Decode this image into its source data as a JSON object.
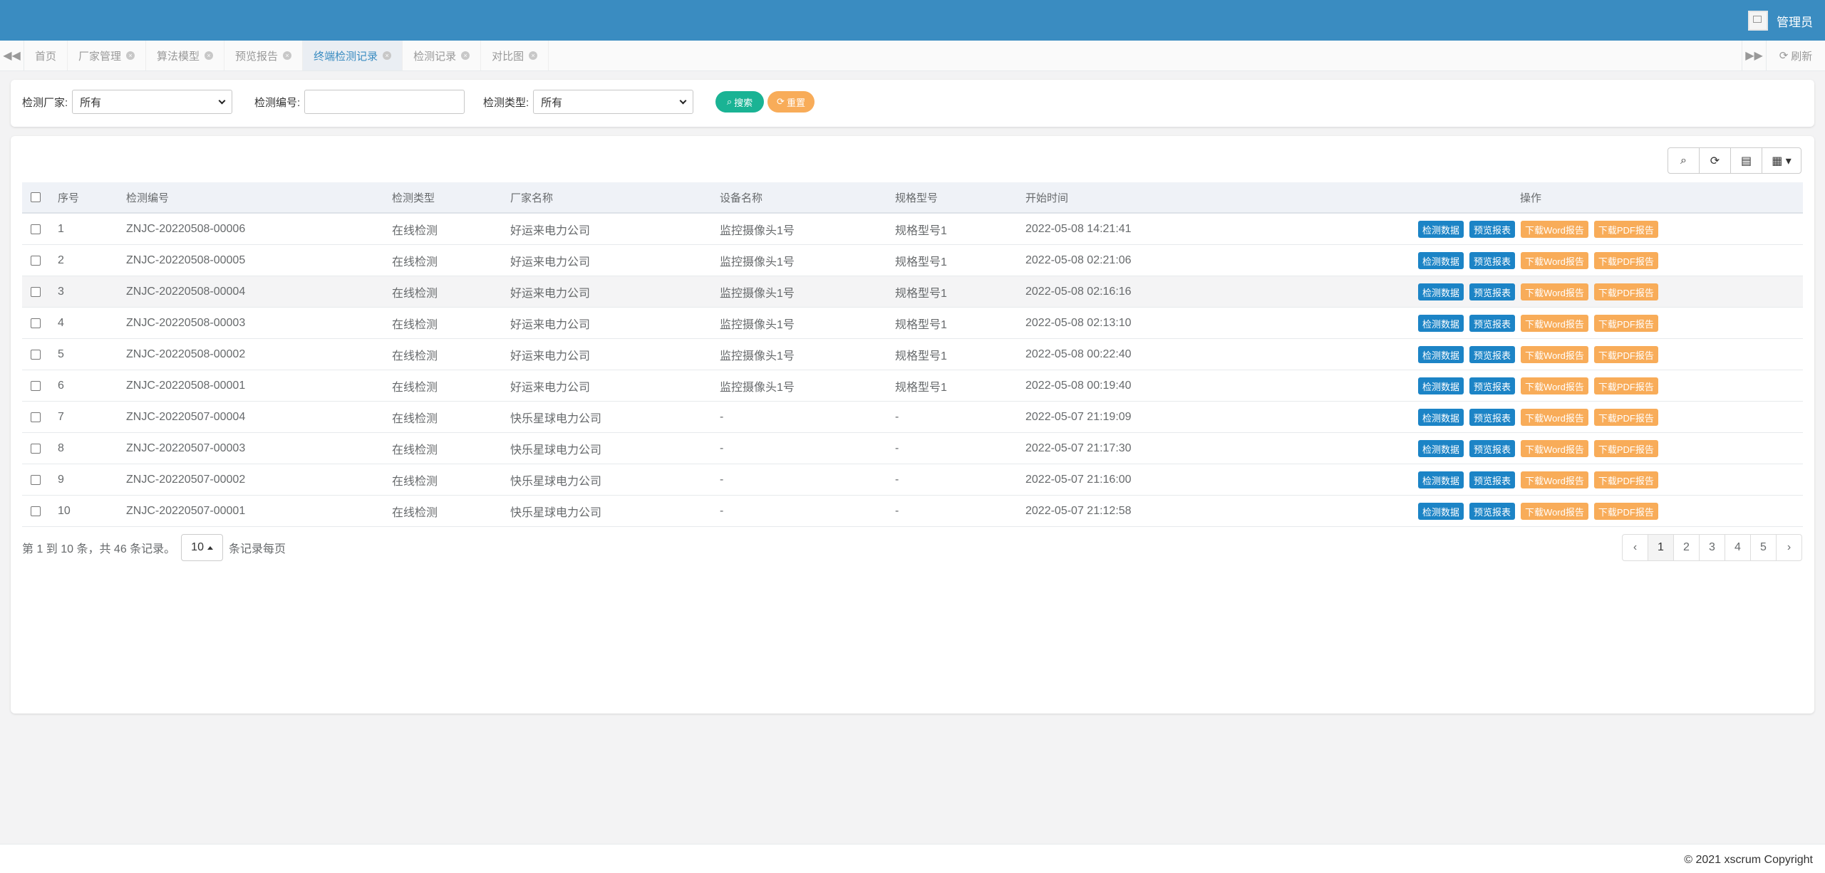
{
  "topbar": {
    "user_name": "管理员"
  },
  "tabs": [
    {
      "label": "首页",
      "closable": false,
      "active": false
    },
    {
      "label": "厂家管理",
      "closable": true,
      "active": false
    },
    {
      "label": "算法模型",
      "closable": true,
      "active": false
    },
    {
      "label": "预览报告",
      "closable": true,
      "active": false
    },
    {
      "label": "终端检测记录",
      "closable": true,
      "active": true
    },
    {
      "label": "检测记录",
      "closable": true,
      "active": false
    },
    {
      "label": "对比图",
      "closable": true,
      "active": false
    }
  ],
  "tabbar": {
    "refresh_label": "刷新"
  },
  "search": {
    "vendor_label": "检测厂家:",
    "vendor_value": "所有",
    "code_label": "检测编号:",
    "code_value": "",
    "type_label": "检测类型:",
    "type_value": "所有",
    "search_button": "搜索",
    "reset_button": "重置"
  },
  "table": {
    "columns": [
      "序号",
      "检测编号",
      "检测类型",
      "厂家名称",
      "设备名称",
      "规格型号",
      "开始时间",
      "操作"
    ],
    "ops": [
      "检测数据",
      "预览报表",
      "下载Word报告",
      "下载PDF报告"
    ],
    "rows": [
      {
        "no": "1",
        "code": "ZNJC-20220508-00006",
        "type": "在线检测",
        "vendor": "好运来电力公司",
        "device": "监控摄像头1号",
        "model": "规格型号1",
        "start": "2022-05-08 14:21:41"
      },
      {
        "no": "2",
        "code": "ZNJC-20220508-00005",
        "type": "在线检测",
        "vendor": "好运来电力公司",
        "device": "监控摄像头1号",
        "model": "规格型号1",
        "start": "2022-05-08 02:21:06"
      },
      {
        "no": "3",
        "code": "ZNJC-20220508-00004",
        "type": "在线检测",
        "vendor": "好运来电力公司",
        "device": "监控摄像头1号",
        "model": "规格型号1",
        "start": "2022-05-08 02:16:16"
      },
      {
        "no": "4",
        "code": "ZNJC-20220508-00003",
        "type": "在线检测",
        "vendor": "好运来电力公司",
        "device": "监控摄像头1号",
        "model": "规格型号1",
        "start": "2022-05-08 02:13:10"
      },
      {
        "no": "5",
        "code": "ZNJC-20220508-00002",
        "type": "在线检测",
        "vendor": "好运来电力公司",
        "device": "监控摄像头1号",
        "model": "规格型号1",
        "start": "2022-05-08 00:22:40"
      },
      {
        "no": "6",
        "code": "ZNJC-20220508-00001",
        "type": "在线检测",
        "vendor": "好运来电力公司",
        "device": "监控摄像头1号",
        "model": "规格型号1",
        "start": "2022-05-08 00:19:40"
      },
      {
        "no": "7",
        "code": "ZNJC-20220507-00004",
        "type": "在线检测",
        "vendor": "快乐星球电力公司",
        "device": "-",
        "model": "-",
        "start": "2022-05-07 21:19:09"
      },
      {
        "no": "8",
        "code": "ZNJC-20220507-00003",
        "type": "在线检测",
        "vendor": "快乐星球电力公司",
        "device": "-",
        "model": "-",
        "start": "2022-05-07 21:17:30"
      },
      {
        "no": "9",
        "code": "ZNJC-20220507-00002",
        "type": "在线检测",
        "vendor": "快乐星球电力公司",
        "device": "-",
        "model": "-",
        "start": "2022-05-07 21:16:00"
      },
      {
        "no": "10",
        "code": "ZNJC-20220507-00001",
        "type": "在线检测",
        "vendor": "快乐星球电力公司",
        "device": "-",
        "model": "-",
        "start": "2022-05-07 21:12:58"
      }
    ]
  },
  "pagination": {
    "summary": "第 1 到 10 条，共 46 条记录。",
    "page_size": "10",
    "per_page_label": "条记录每页",
    "prev": "‹",
    "next": "›",
    "pages": [
      "1",
      "2",
      "3",
      "4",
      "5"
    ],
    "current": "1"
  },
  "footer": {
    "copyright": "© 2021 xscrum Copyright"
  },
  "colors": {
    "brand": "#3a8cc1",
    "primary_button": "#1c84c6",
    "warning_button": "#f8ac59",
    "search_button": "#1ab394"
  }
}
